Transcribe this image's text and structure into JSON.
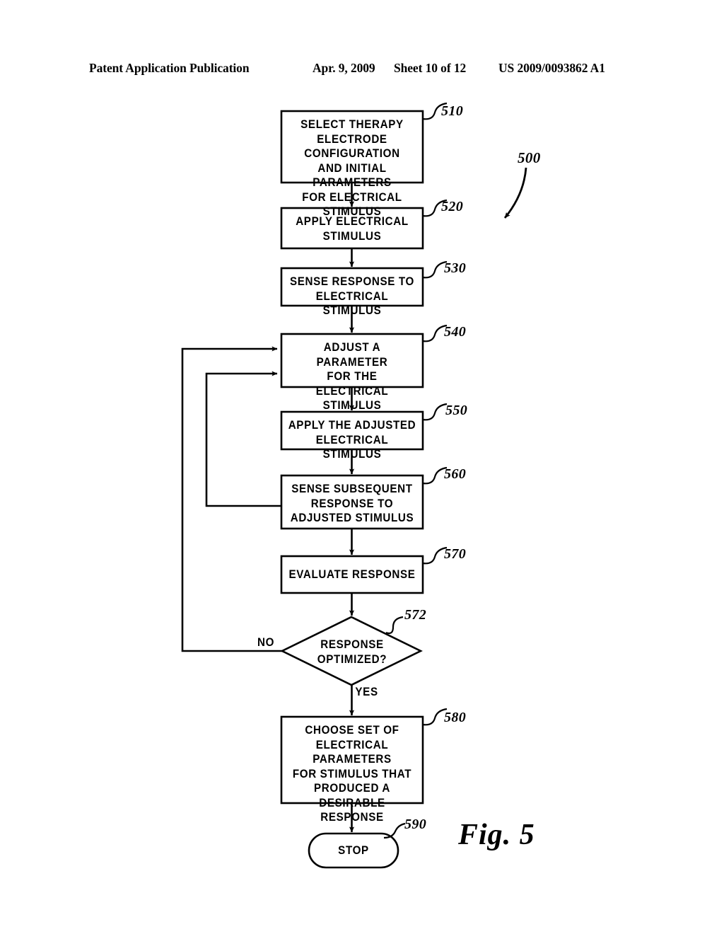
{
  "header": {
    "publication": "Patent Application Publication",
    "date": "Apr. 9, 2009",
    "sheet": "Sheet 10 of 12",
    "patent_number": "US 2009/0093862 A1"
  },
  "figure": {
    "caption": "Fig.  5",
    "diagram_ref": "500"
  },
  "flowchart": {
    "nodes": [
      {
        "ref": "510",
        "shape": "process",
        "text": "SELECT THERAPY\nELECTRODE CONFIGURATION\nAND INITIAL PARAMETERS\nFOR ELECTRICAL STIMULUS"
      },
      {
        "ref": "520",
        "shape": "process",
        "text": "APPLY ELECTRICAL\nSTIMULUS"
      },
      {
        "ref": "530",
        "shape": "process",
        "text": "SENSE RESPONSE TO\nELECTRICAL STIMULUS"
      },
      {
        "ref": "540",
        "shape": "process",
        "text": "ADJUST A PARAMETER\nFOR THE\nELECTRICAL STIMULUS"
      },
      {
        "ref": "550",
        "shape": "process",
        "text": "APPLY THE ADJUSTED\nELECTRICAL STIMULUS"
      },
      {
        "ref": "560",
        "shape": "process",
        "text": "SENSE SUBSEQUENT\nRESPONSE TO\nADJUSTED STIMULUS"
      },
      {
        "ref": "570",
        "shape": "process",
        "text": "EVALUATE RESPONSE"
      },
      {
        "ref": "572",
        "shape": "decision",
        "text": "RESPONSE\nOPTIMIZED?"
      },
      {
        "ref": "580",
        "shape": "process",
        "text": "CHOOSE SET OF\nELECTRICAL PARAMETERS\nFOR STIMULUS THAT\nPRODUCED A\nDESIRABLE RESPONSE"
      },
      {
        "ref": "590",
        "shape": "terminator",
        "text": "STOP"
      }
    ],
    "branch_labels": {
      "no": "NO",
      "yes": "YES"
    }
  },
  "colors": {
    "ink": "#000000",
    "paper": "#ffffff"
  }
}
